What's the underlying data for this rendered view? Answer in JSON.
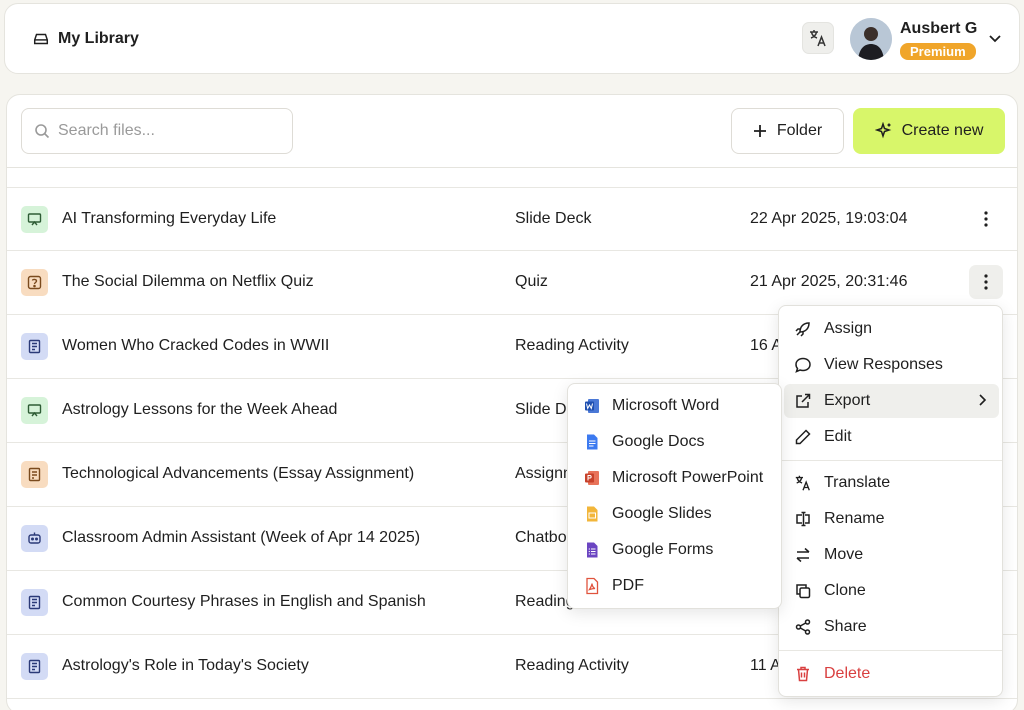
{
  "header": {
    "title": "My Library",
    "user_name": "Ausbert G",
    "plan_badge": "Premium"
  },
  "toolbar": {
    "search_placeholder": "Search files...",
    "folder_label": "Folder",
    "create_label": "Create new"
  },
  "files": [
    {
      "name": "AI Transforming Everyday Life",
      "type": "Slide Deck",
      "date": "22 Apr 2025, 19:03:04",
      "icon": "presentation-icon"
    },
    {
      "name": "The Social Dilemma on Netflix Quiz",
      "type": "Quiz",
      "date": "21 Apr 2025, 20:31:46",
      "icon": "quiz-icon"
    },
    {
      "name": "Women Who Cracked Codes in WWII",
      "type": "Reading Activity",
      "date": "16 A",
      "icon": "reading-icon"
    },
    {
      "name": "Astrology Lessons for the Week Ahead",
      "type": "Slide D",
      "date": "",
      "icon": "presentation-icon"
    },
    {
      "name": "Technological Advancements (Essay Assignment)",
      "type": "Assignm",
      "date": "",
      "icon": "assignment-icon"
    },
    {
      "name": "Classroom Admin Assistant (Week of Apr 14 2025)",
      "type": "Chatbo",
      "date": "",
      "icon": "chatbot-icon"
    },
    {
      "name": "Common Courtesy Phrases in English and Spanish",
      "type": "Reading",
      "date": "",
      "icon": "reading-icon"
    },
    {
      "name": "Astrology's Role in Today's Society",
      "type": "Reading Activity",
      "date": "11 A",
      "icon": "reading-icon"
    }
  ],
  "context_menu": {
    "assign": "Assign",
    "view_responses": "View Responses",
    "export": "Export",
    "edit": "Edit",
    "translate": "Translate",
    "rename": "Rename",
    "move": "Move",
    "clone": "Clone",
    "share": "Share",
    "delete": "Delete"
  },
  "export_menu": {
    "word": "Microsoft Word",
    "docs": "Google Docs",
    "powerpoint": "Microsoft PowerPoint",
    "slides": "Google Slides",
    "forms": "Google Forms",
    "pdf": "PDF"
  },
  "colors": {
    "accent": "#d8f66a",
    "premium": "#f0a52a",
    "danger": "#d94040"
  }
}
